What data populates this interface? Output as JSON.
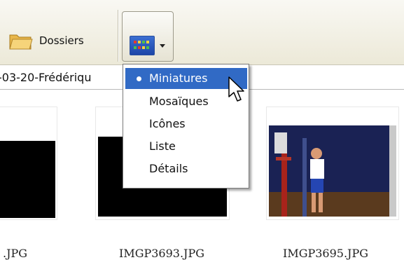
{
  "toolbar": {
    "folders_label": "Dossiers",
    "views_icon": "views-grid-icon"
  },
  "address": {
    "path": "-03-20-Frédériqu"
  },
  "files": [
    {
      "name": ".JPG"
    },
    {
      "name": "IMGP3693.JPG"
    },
    {
      "name": "IMGP3695.JPG"
    }
  ],
  "views_menu": {
    "items": [
      {
        "label": "Miniatures",
        "selected": true
      },
      {
        "label": "Mosaïques"
      },
      {
        "label": "Icônes"
      },
      {
        "label": "Liste"
      },
      {
        "label": "Détails"
      }
    ]
  },
  "colors": {
    "selection": "#316ac5",
    "toolbar": "#ece9d8"
  }
}
